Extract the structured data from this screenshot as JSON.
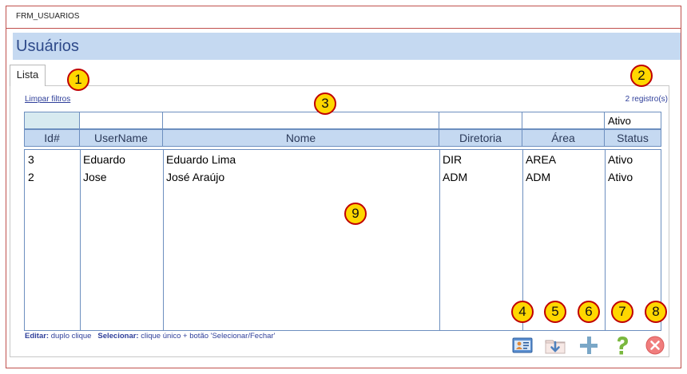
{
  "window": {
    "title": "FRM_USUARIOS"
  },
  "header": {
    "title": "Usuários"
  },
  "tabs": [
    {
      "label": "Lista"
    }
  ],
  "toolbar_top": {
    "clear_filters": "Limpar filtros",
    "record_count": "2 registro(s)"
  },
  "filters": {
    "status_value": "Ativo"
  },
  "columns": [
    "Id#",
    "UserName",
    "Nome",
    "Diretoria",
    "Área",
    "Status"
  ],
  "rows": [
    {
      "id": "3",
      "username": "Eduardo",
      "nome": "Eduardo Lima",
      "diretoria": "DIR",
      "area": "AREA",
      "status": "Ativo"
    },
    {
      "id": "2",
      "username": "Jose",
      "nome": "José Araújo",
      "diretoria": "ADM",
      "area": "ADM",
      "status": "Ativo"
    }
  ],
  "hint": {
    "edit_label": "Editar:",
    "edit_text": "duplo clique",
    "select_label": "Selecionar:",
    "select_text": "clique único + botão 'Selecionar/Fechar'"
  },
  "buttons": [
    {
      "icon": "id-card-icon"
    },
    {
      "icon": "export-folder-icon"
    },
    {
      "icon": "plus-icon"
    },
    {
      "icon": "help-icon"
    },
    {
      "icon": "close-icon"
    }
  ],
  "callouts": [
    "1",
    "2",
    "3",
    "4",
    "5",
    "6",
    "7",
    "8",
    "9"
  ],
  "colors": {
    "accent": "#c0504d",
    "header_band": "#c5d9f1",
    "callout_fill": "#ffd700",
    "callout_border": "#c00000"
  }
}
